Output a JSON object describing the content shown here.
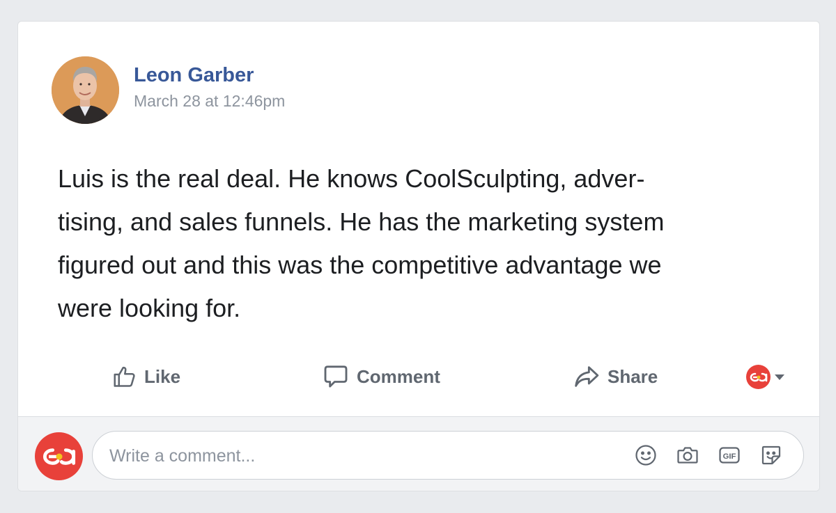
{
  "post": {
    "author": "Leon Garber",
    "timestamp": "March 28 at 12:46pm",
    "text_lines": [
      "Luis is the real deal. He knows CoolSculpting, adver-",
      "tising, and sales funnels. He has the marketing system",
      "figured out and this was the competitive advantage we",
      "were looking for."
    ]
  },
  "actions": {
    "like_label": "Like",
    "comment_label": "Comment",
    "share_label": "Share"
  },
  "comment_box": {
    "placeholder": "Write a comment..."
  },
  "icons": {
    "like": "thumbs-up-icon",
    "comment": "speech-bubble-icon",
    "share": "share-arrow-icon",
    "emoji": "smiley-icon",
    "camera": "camera-icon",
    "gif": "gif-icon",
    "sticker": "sticker-icon"
  },
  "colors": {
    "brand_red": "#e8413a",
    "author_blue": "#385898",
    "muted_gray": "#8d949e",
    "action_gray": "#606770"
  }
}
